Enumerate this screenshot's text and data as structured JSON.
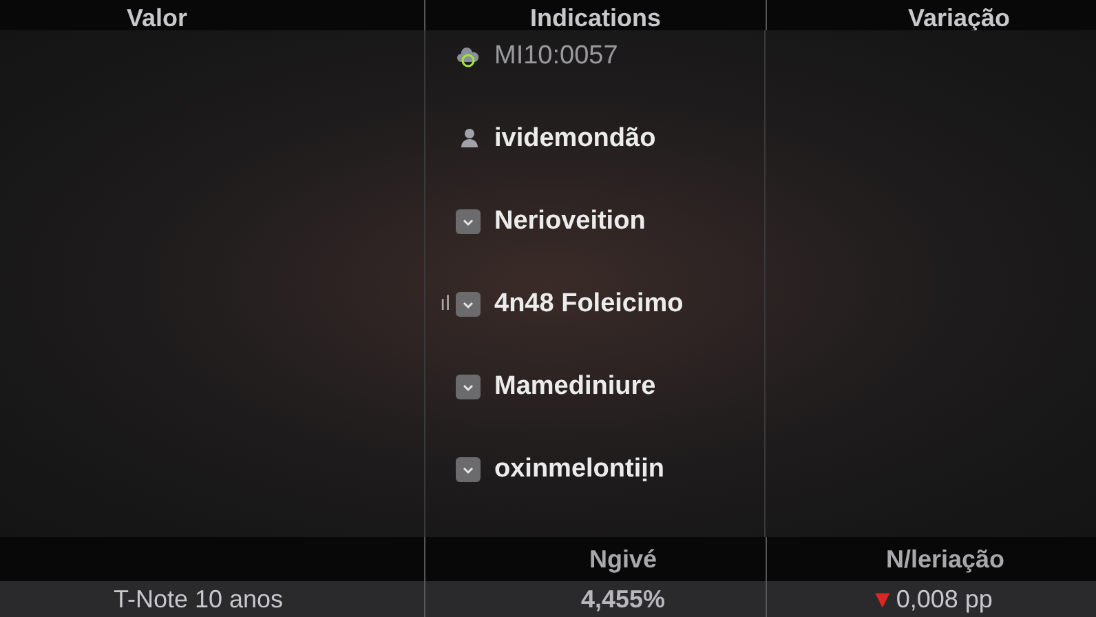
{
  "columns": [
    "Valor",
    "Indications",
    "Variação"
  ],
  "indications": [
    {
      "kind": "cloud",
      "label": "MI10:0057",
      "muted": true
    },
    {
      "kind": "person",
      "label": "ividemondão",
      "muted": false
    },
    {
      "kind": "checkbox",
      "label": "Nerioveition",
      "checked": true,
      "muted": false
    },
    {
      "kind": "checkbox",
      "label": "4n48 Foleicimo",
      "checked": true,
      "muted": false,
      "marker": "ıl"
    },
    {
      "kind": "checkbox",
      "label": "Mamediniure",
      "checked": true,
      "muted": false
    },
    {
      "kind": "checkbox",
      "label": "oxinmelontiịn",
      "checked": true,
      "muted": false
    }
  ],
  "footer_columns": [
    "Ngivé",
    "N/leriação"
  ],
  "row": {
    "name": "T-Note 10 anos",
    "value": "4,455%",
    "change_icon": "▼",
    "change": "0,008 pp"
  }
}
